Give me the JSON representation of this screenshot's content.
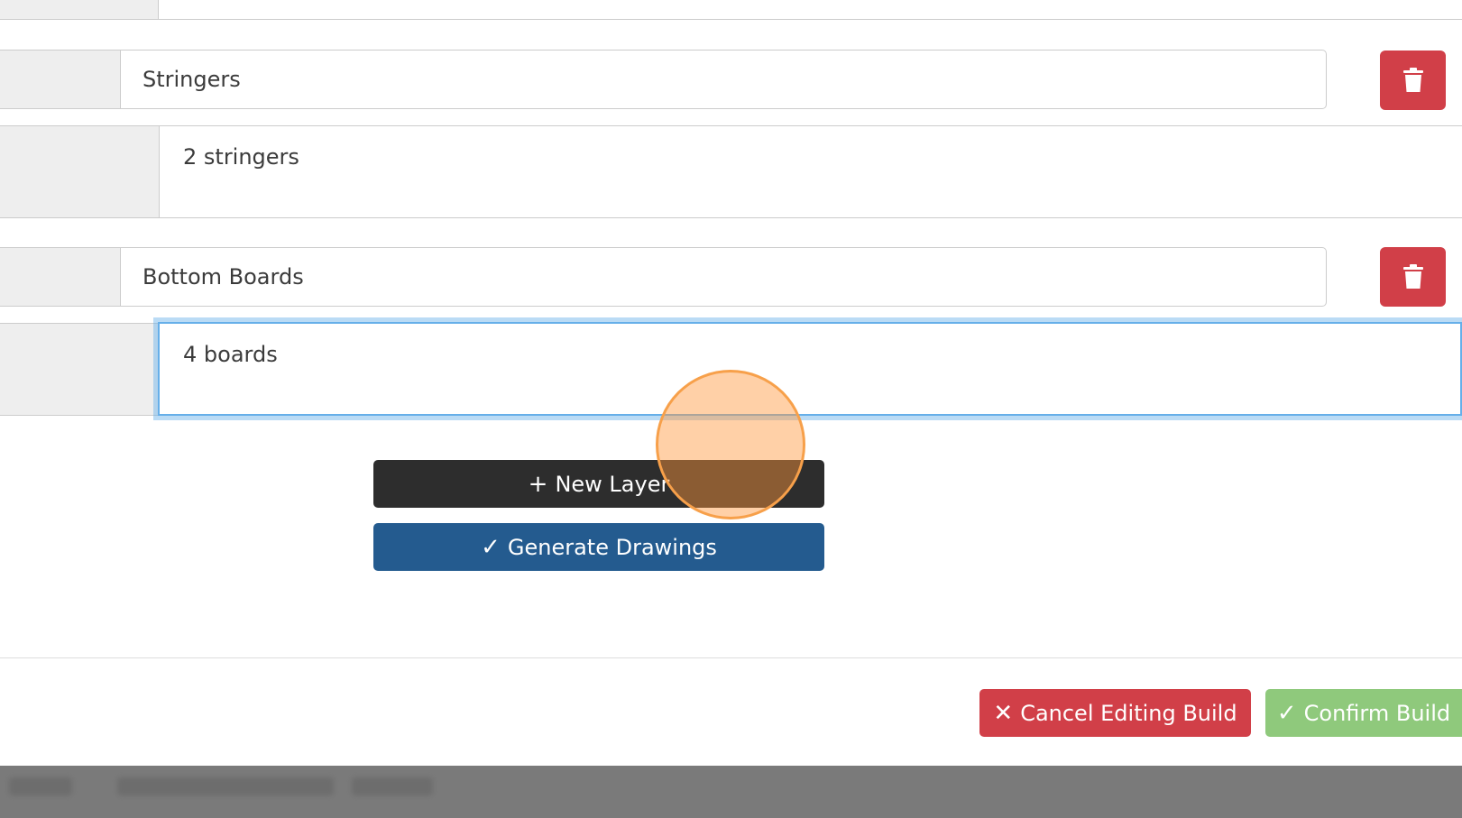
{
  "layers": [
    {
      "name": "Stringers",
      "description": "2 stringers"
    },
    {
      "name": "Bottom Boards",
      "description": "4 boards"
    }
  ],
  "actions": {
    "new_layer": {
      "icon": "plus-icon",
      "label": "New Layer"
    },
    "generate": {
      "icon": "check-icon",
      "label": "Generate Drawings"
    }
  },
  "footer": {
    "cancel": {
      "icon": "close-icon",
      "label": "Cancel Editing Build"
    },
    "confirm": {
      "icon": "check-icon",
      "label": "Confirm Build"
    }
  },
  "colors": {
    "danger": "#d13f48",
    "primary": "#245b8f",
    "dark": "#2d2d2d",
    "success": "#8fc97c",
    "focus": "#66afe9"
  }
}
